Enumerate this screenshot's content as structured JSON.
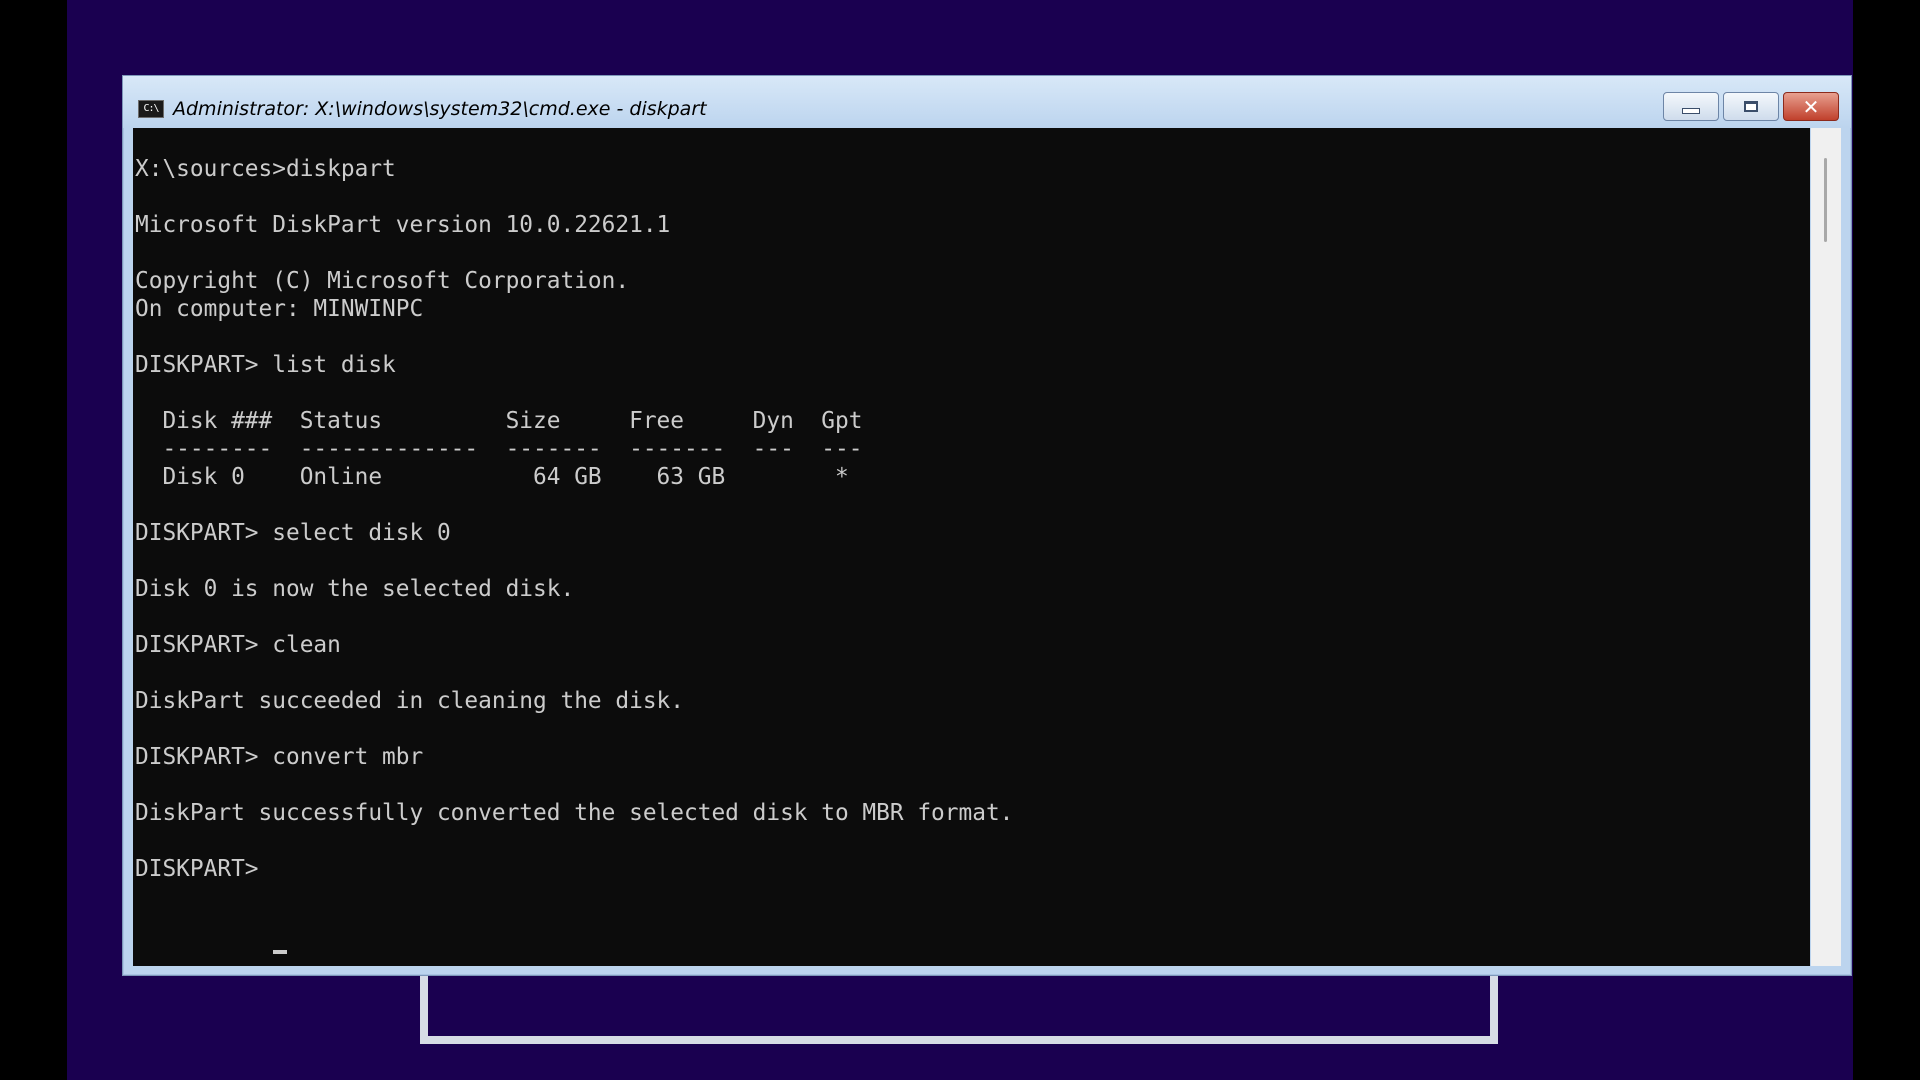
{
  "window": {
    "title": "Administrator: X:\\windows\\system32\\cmd.exe - diskpart",
    "icon": "cmd-icon",
    "icon_label": "C:\\",
    "buttons": {
      "minimize": "minimize-icon",
      "maximize": "maximize-icon",
      "close": "close-icon",
      "close_glyph": "✕"
    }
  },
  "console": {
    "lines": [
      "X:\\sources>diskpart",
      "",
      "Microsoft DiskPart version 10.0.22621.1",
      "",
      "Copyright (C) Microsoft Corporation.",
      "On computer: MINWINPC",
      "",
      "DISKPART> list disk",
      "",
      "  Disk ###  Status         Size     Free     Dyn  Gpt",
      "  --------  -------------  -------  -------  ---  ---",
      "  Disk 0    Online           64 GB    63 GB        *",
      "",
      "DISKPART> select disk 0",
      "",
      "Disk 0 is now the selected disk.",
      "",
      "DISKPART> clean",
      "",
      "DiskPart succeeded in cleaning the disk.",
      "",
      "DISKPART> convert mbr",
      "",
      "DiskPart successfully converted the selected disk to MBR format.",
      "",
      "DISKPART> "
    ],
    "colors": {
      "background": "#0c0c0c",
      "foreground": "#cccccc"
    }
  },
  "colors": {
    "desktop": "#1a0050",
    "window_frame": "#bcd4ee",
    "close_button": "#c0402c"
  }
}
